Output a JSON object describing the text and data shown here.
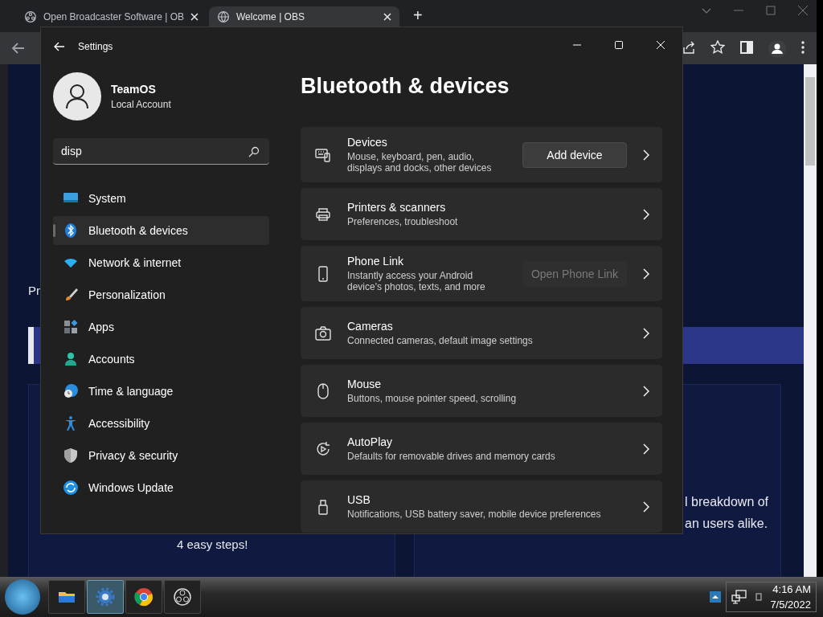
{
  "browser": {
    "tabs": [
      {
        "title": "Open Broadcaster Software | OB",
        "selected": false
      },
      {
        "title": "Welcome | OBS",
        "selected": true
      }
    ],
    "new_tab": "+",
    "page_texts": [
      "Pr",
      "l breakdown of",
      "an users alike.",
      "4 easy steps!"
    ]
  },
  "settings": {
    "window": {
      "title": "Settings"
    },
    "user": {
      "name": "TeamOS",
      "account": "Local Account"
    },
    "search": {
      "value": "disp"
    },
    "nav": [
      {
        "label": "System",
        "selected": false
      },
      {
        "label": "Bluetooth & devices",
        "selected": true
      },
      {
        "label": "Network & internet",
        "selected": false
      },
      {
        "label": "Personalization",
        "selected": false
      },
      {
        "label": "Apps",
        "selected": false
      },
      {
        "label": "Accounts",
        "selected": false
      },
      {
        "label": "Time & language",
        "selected": false
      },
      {
        "label": "Accessibility",
        "selected": false
      },
      {
        "label": "Privacy & security",
        "selected": false
      },
      {
        "label": "Windows Update",
        "selected": false
      }
    ],
    "heading": "Bluetooth & devices",
    "cards": [
      {
        "title": "Devices",
        "subtitle": "Mouse, keyboard, pen, audio, displays and docks, other devices",
        "button": {
          "label": "Add device",
          "disabled": false
        }
      },
      {
        "title": "Printers & scanners",
        "subtitle": "Preferences, troubleshoot"
      },
      {
        "title": "Phone Link",
        "subtitle": "Instantly access your Android device's photos, texts, and more",
        "button": {
          "label": "Open Phone Link",
          "disabled": true
        }
      },
      {
        "title": "Cameras",
        "subtitle": "Connected cameras, default image settings"
      },
      {
        "title": "Mouse",
        "subtitle": "Buttons, mouse pointer speed, scrolling"
      },
      {
        "title": "AutoPlay",
        "subtitle": "Defaults for removable drives and memory cards"
      },
      {
        "title": "USB",
        "subtitle": "Notifications, USB battery saver, mobile device preferences"
      }
    ]
  },
  "taskbar": {
    "apps": [
      {
        "selected": false
      },
      {
        "selected": true
      },
      {
        "selected": false
      },
      {
        "selected": false
      }
    ],
    "clock": {
      "time": "4:16 AM",
      "date": "7/5/2022"
    }
  }
}
